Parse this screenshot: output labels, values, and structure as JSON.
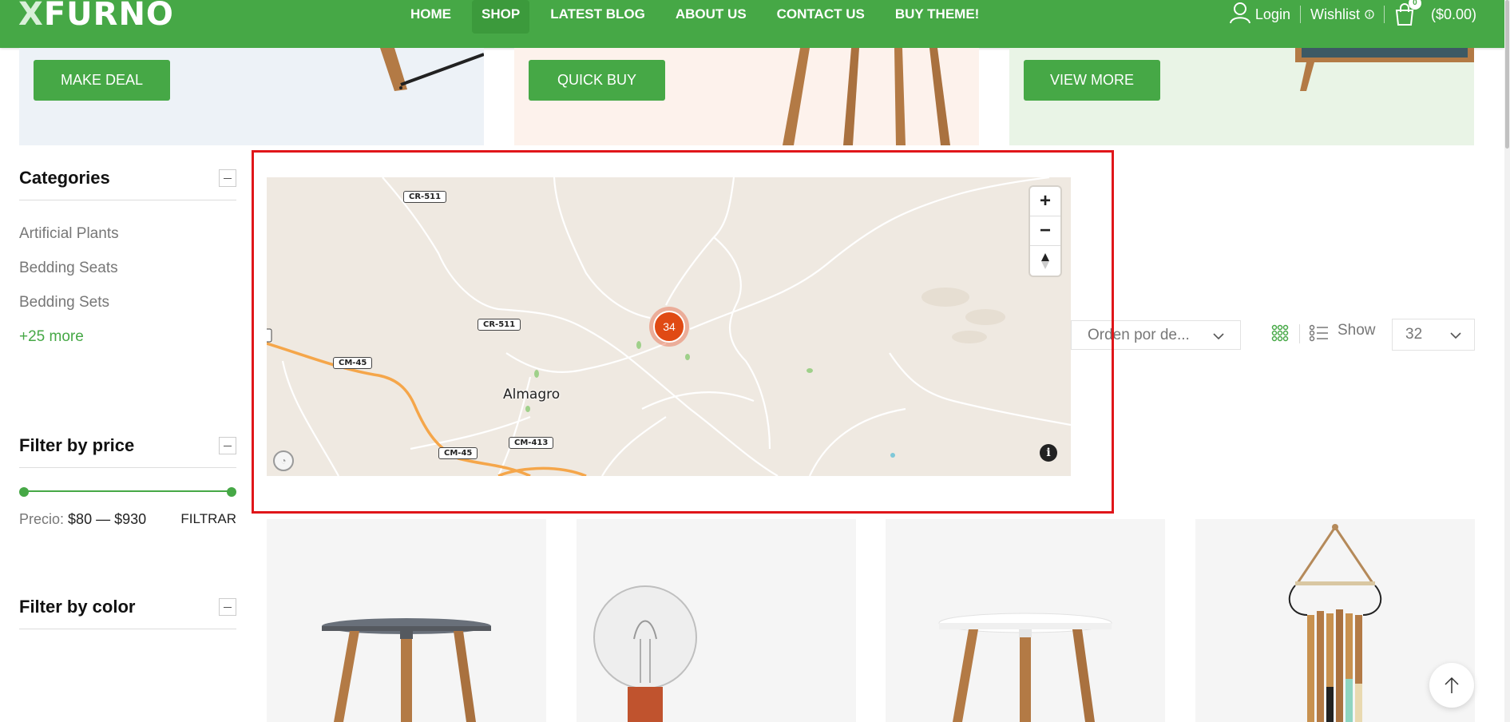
{
  "brand": {
    "logo_x": "X",
    "logo_rest": "FURNO",
    "accent": "#46a846"
  },
  "nav": [
    {
      "label": "HOME"
    },
    {
      "label": "SHOP",
      "active": true
    },
    {
      "label": "LATEST BLOG"
    },
    {
      "label": "ABOUT US"
    },
    {
      "label": "CONTACT US"
    },
    {
      "label": "BUY THEME!"
    }
  ],
  "header": {
    "login": "Login",
    "wishlist": "Wishlist",
    "cart_count": "0",
    "cart_total": "($0.00)"
  },
  "banners": [
    {
      "button": "MAKE DEAL"
    },
    {
      "button": "QUICK BUY"
    },
    {
      "button": "VIEW MORE"
    }
  ],
  "sidebar": {
    "categories_title": "Categories",
    "categories": [
      "Artificial Plants",
      "Bedding Seats",
      "Bedding Sets"
    ],
    "more": "+25 more",
    "price_title": "Filter by price",
    "price_label": "Precio:",
    "price_range": "$80 — $930",
    "filter_button": "FILTRAR",
    "color_title": "Filter by color"
  },
  "map": {
    "town": "Almagro",
    "cluster_count": "34",
    "roads": [
      "CR-511",
      "CR-511",
      "CM-45",
      "CM-45",
      "CM-413"
    ],
    "highlight_color": "#e0161a"
  },
  "toolbar": {
    "sort_value": "Orden por de...",
    "show_label": "Show",
    "show_value": "32"
  }
}
